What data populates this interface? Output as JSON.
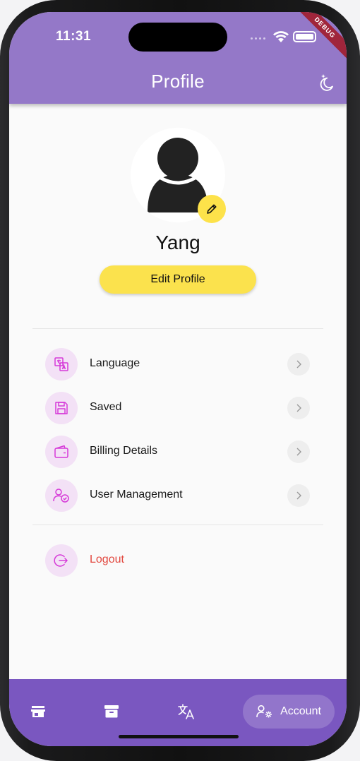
{
  "status_bar": {
    "time": "11:31"
  },
  "app_bar": {
    "title": "Profile",
    "debug_banner": "DEBUG"
  },
  "profile": {
    "name": "Yang",
    "edit_profile_label": "Edit Profile"
  },
  "menu": {
    "items": [
      {
        "label": "Language",
        "icon": "language-icon"
      },
      {
        "label": "Saved",
        "icon": "save-icon"
      },
      {
        "label": "Billing Details",
        "icon": "wallet-icon"
      },
      {
        "label": "User Management",
        "icon": "user-check-icon"
      }
    ],
    "logout": {
      "label": "Logout",
      "icon": "logout-icon"
    }
  },
  "bottom_nav": {
    "items": [
      {
        "icon": "store-icon"
      },
      {
        "icon": "archive-icon"
      },
      {
        "icon": "translate-icon"
      },
      {
        "icon": "user-settings-icon",
        "label": "Account",
        "active": true
      }
    ]
  },
  "colors": {
    "app_bar": "#9478c8",
    "bottom_nav": "#7a57c0",
    "accent_yellow": "#fbe24d",
    "icon_bg": "#f3e1f6",
    "icon_stroke": "#d63ad8",
    "logout_text": "#e2483f"
  }
}
